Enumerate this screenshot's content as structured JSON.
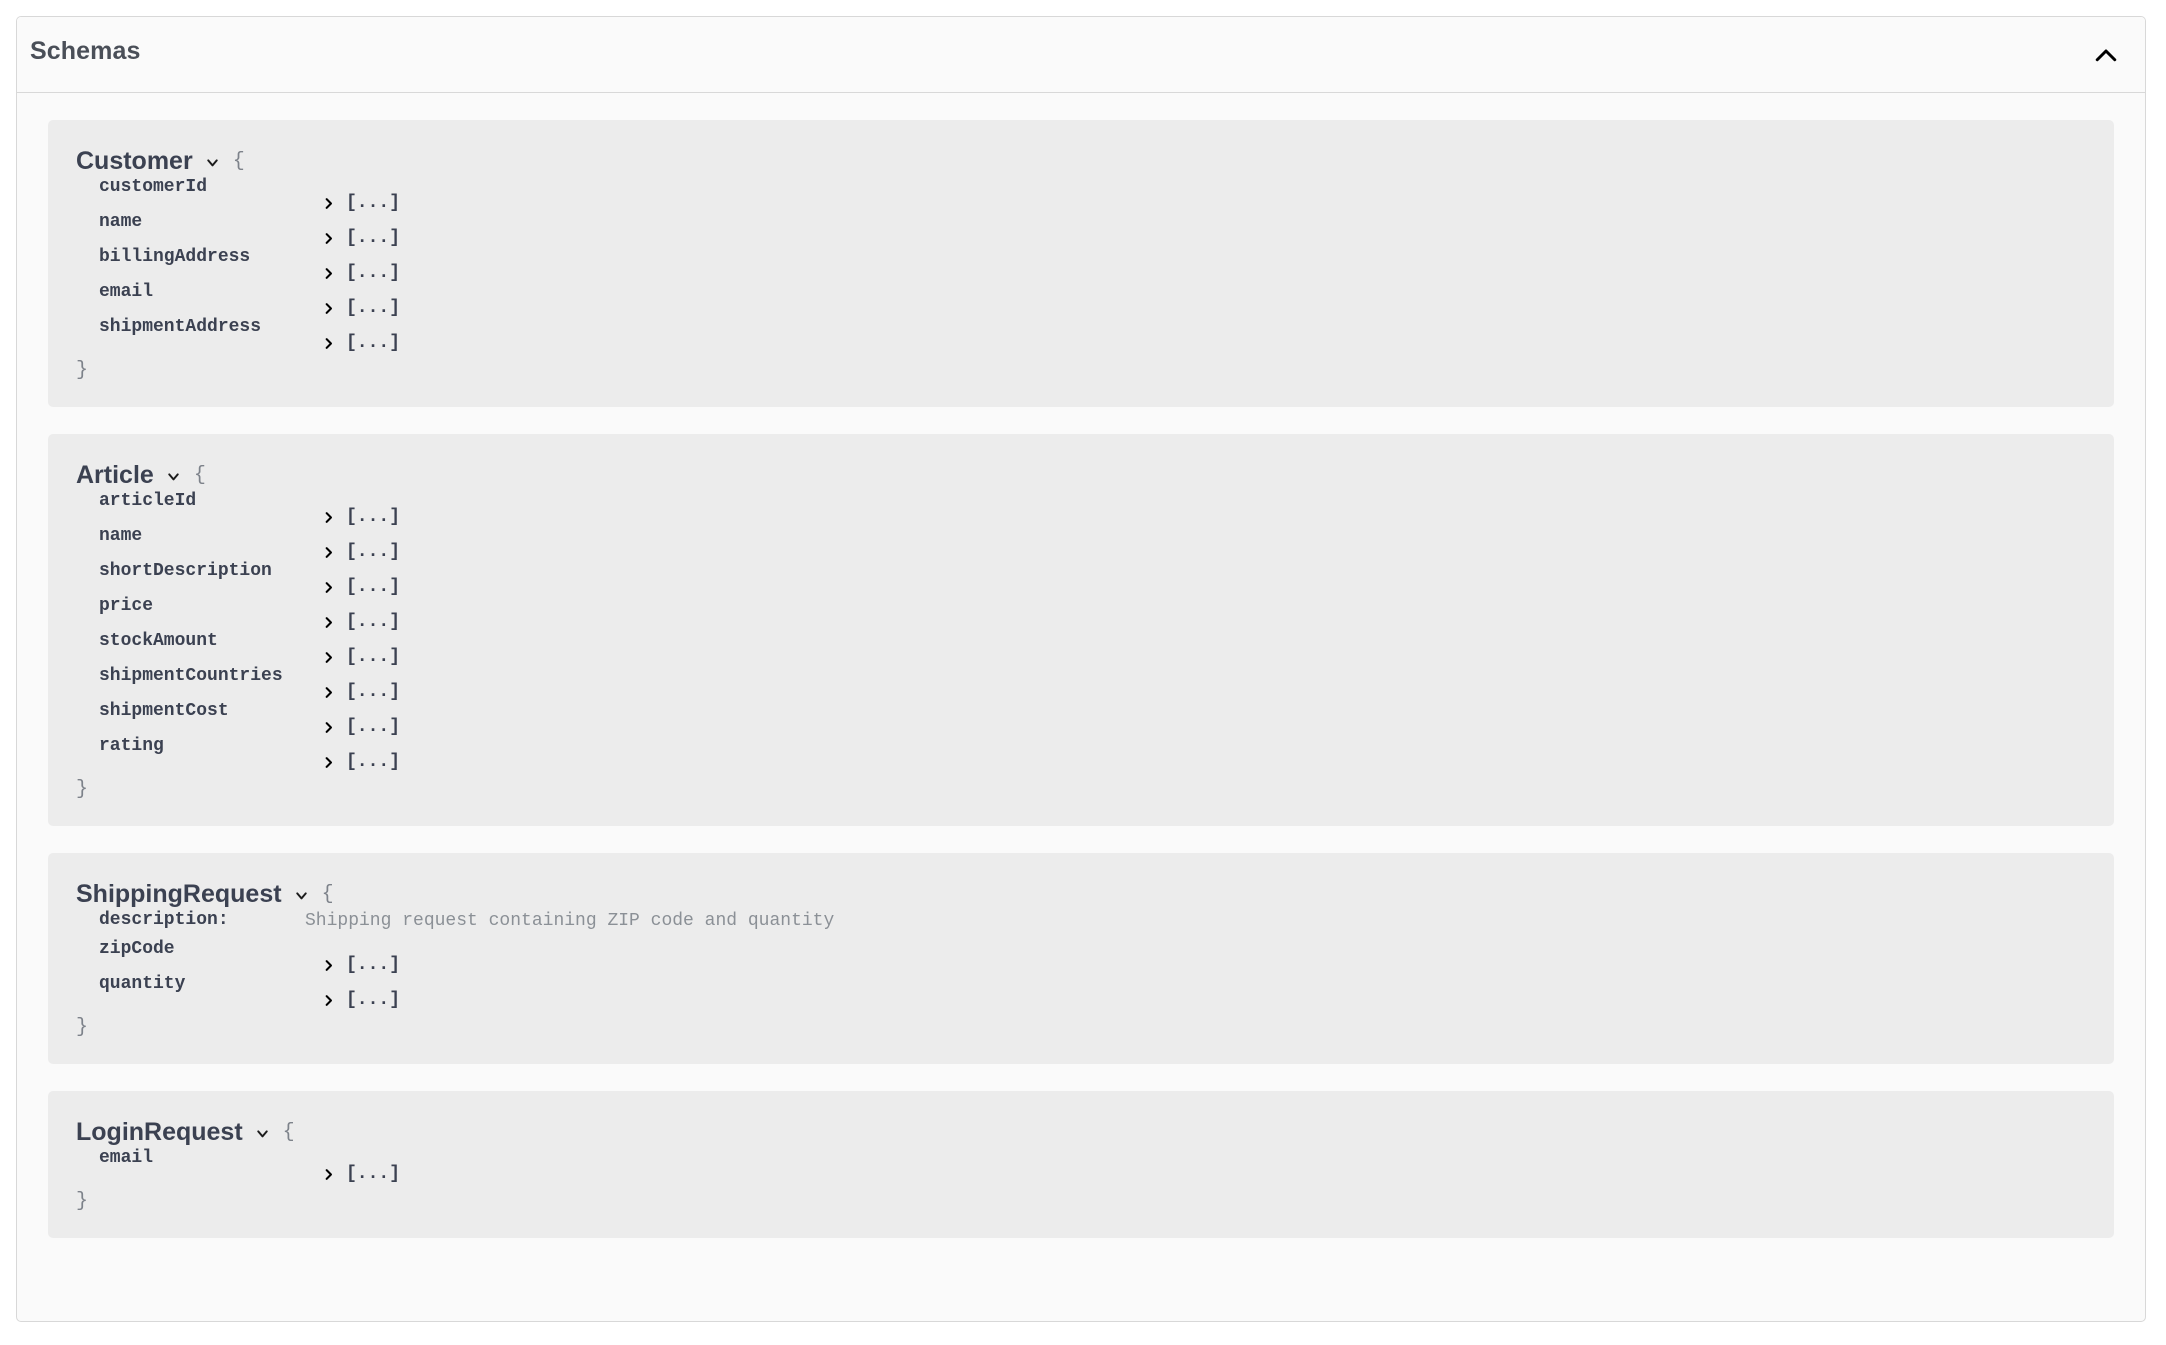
{
  "header": {
    "title": "Schemas",
    "collapse_icon": "chevron-up-icon"
  },
  "icons": {
    "schema_toggle": "chevron-down-icon",
    "property_expand": "chevron-right-icon"
  },
  "syntax": {
    "open_brace": "{",
    "close_brace": "}",
    "collapsed_value": "[...]"
  },
  "schemas": [
    {
      "name": "Customer",
      "description": null,
      "properties": [
        {
          "name": "customerId",
          "value": "[...]"
        },
        {
          "name": "name",
          "value": "[...]"
        },
        {
          "name": "billingAddress",
          "value": "[...]"
        },
        {
          "name": "email",
          "value": "[...]"
        },
        {
          "name": "shipmentAddress",
          "value": "[...]"
        }
      ]
    },
    {
      "name": "Article",
      "description": null,
      "properties": [
        {
          "name": "articleId",
          "value": "[...]"
        },
        {
          "name": "name",
          "value": "[...]"
        },
        {
          "name": "shortDescription",
          "value": "[...]"
        },
        {
          "name": "price",
          "value": "[...]"
        },
        {
          "name": "stockAmount",
          "value": "[...]"
        },
        {
          "name": "shipmentCountries",
          "value": "[...]"
        },
        {
          "name": "shipmentCost",
          "value": "[...]"
        },
        {
          "name": "rating",
          "value": "[...]"
        }
      ]
    },
    {
      "name": "ShippingRequest",
      "description": {
        "label": "description:",
        "text": "Shipping request containing ZIP code and quantity"
      },
      "properties": [
        {
          "name": "zipCode",
          "value": "[...]"
        },
        {
          "name": "quantity",
          "value": "[...]"
        }
      ]
    },
    {
      "name": "LoginRequest",
      "description": null,
      "properties": [
        {
          "name": "email",
          "value": "[...]"
        }
      ]
    }
  ],
  "colors": {
    "card_background": "#fafafa",
    "card_border": "#d8d8d8",
    "block_background": "#ececec",
    "title_text": "#4a4f58",
    "schema_name_text": "#3b4151",
    "brace_text": "#7d828a",
    "description_text": "#8b9096"
  }
}
